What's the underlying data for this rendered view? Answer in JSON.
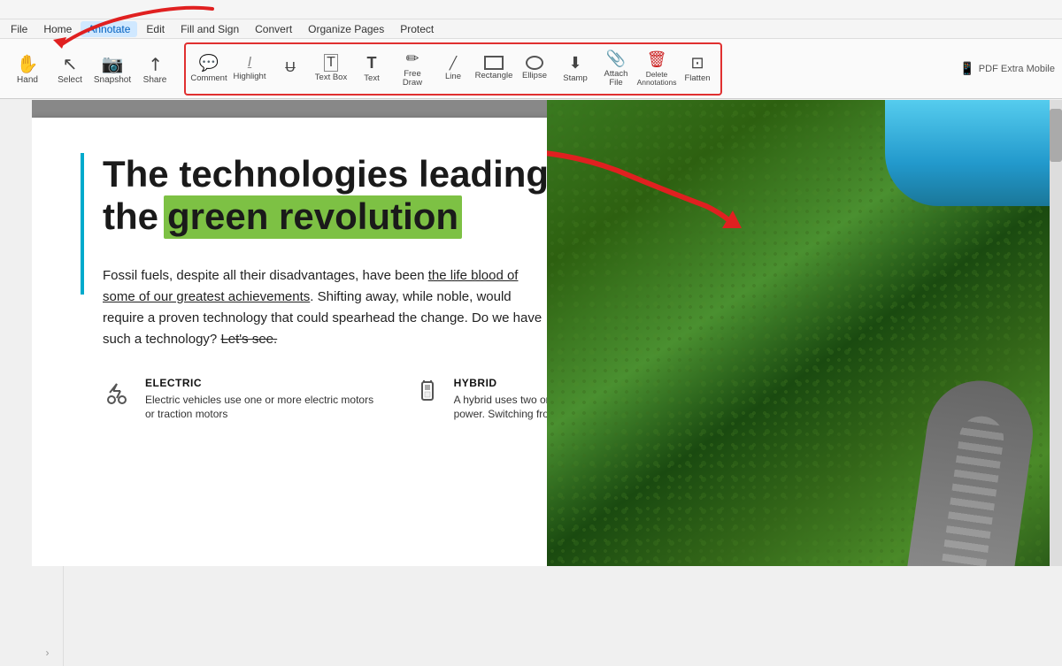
{
  "app": {
    "title": "PDF Extra Mobile",
    "window_title": ""
  },
  "menu": {
    "items": [
      {
        "label": "File",
        "active": false
      },
      {
        "label": "Home",
        "active": false
      },
      {
        "label": "Annotate",
        "active": true
      },
      {
        "label": "Edit",
        "active": false
      },
      {
        "label": "Fill and Sign",
        "active": false
      },
      {
        "label": "Convert",
        "active": false
      },
      {
        "label": "Organize Pages",
        "active": false
      },
      {
        "label": "Protect",
        "active": false
      }
    ]
  },
  "toolbar": {
    "left_tools": [
      {
        "id": "hand",
        "label": "Hand",
        "icon": "✋"
      },
      {
        "id": "select",
        "label": "Select",
        "icon": "↖"
      },
      {
        "id": "snapshot",
        "label": "Snapshot",
        "icon": "📷"
      },
      {
        "id": "share",
        "label": "Share",
        "icon": "↗"
      }
    ],
    "annotate_tools": [
      {
        "id": "comment",
        "label": "Comment",
        "icon": "💬"
      },
      {
        "id": "highlight",
        "label": "Highlight",
        "icon": "🖊"
      },
      {
        "id": "strikethrough",
        "label": "",
        "icon": "S̶"
      },
      {
        "id": "textbox",
        "label": "Text Box",
        "icon": "⊡"
      },
      {
        "id": "text",
        "label": "Text",
        "icon": "T"
      },
      {
        "id": "freedraw",
        "label": "Free Draw",
        "icon": "✏"
      },
      {
        "id": "line",
        "label": "Line",
        "icon": "╱"
      },
      {
        "id": "rectangle",
        "label": "Rectangle",
        "icon": "□"
      },
      {
        "id": "ellipse",
        "label": "Ellipse",
        "icon": "○"
      },
      {
        "id": "stamp",
        "label": "Stamp",
        "icon": "⬇"
      },
      {
        "id": "attachfile",
        "label": "Attach File",
        "icon": "📎"
      },
      {
        "id": "deleteannotations",
        "label": "Delete Annotations",
        "icon": "🗑"
      },
      {
        "id": "flatten",
        "label": "Flatten",
        "icon": "⊡"
      }
    ],
    "pdf_extra_label": "PDF Extra Mobile"
  },
  "sidebar": {
    "icons": [
      {
        "id": "layers",
        "icon": "≡"
      },
      {
        "id": "bookmark",
        "icon": "🔖"
      },
      {
        "id": "search",
        "icon": "🔍"
      },
      {
        "id": "attachments",
        "icon": "📎"
      },
      {
        "id": "comments",
        "icon": "💬"
      },
      {
        "id": "pen",
        "icon": "✏"
      }
    ]
  },
  "pdf": {
    "title_line1": "The technologies leading",
    "title_line2_prefix": "the",
    "title_highlight": "green revolution",
    "body_text_1": "Fossil fuels, despite all their disadvantages, have been the life blood of some of our greatest achievements. Shifting away, while noble, would require a proven technology that could spearhead the change. Do we have such a technology?",
    "strikethrough_text": "Let's see.",
    "features": [
      {
        "id": "electric",
        "icon": "⚡",
        "title": "ELECTRIC",
        "description": "Electric vehicles use one or more electric motors or traction motors"
      },
      {
        "id": "hybrid",
        "icon": "🔋",
        "title": "HYBRID",
        "description": "A hybrid uses two or more distinct types of power. Switching from"
      }
    ]
  }
}
